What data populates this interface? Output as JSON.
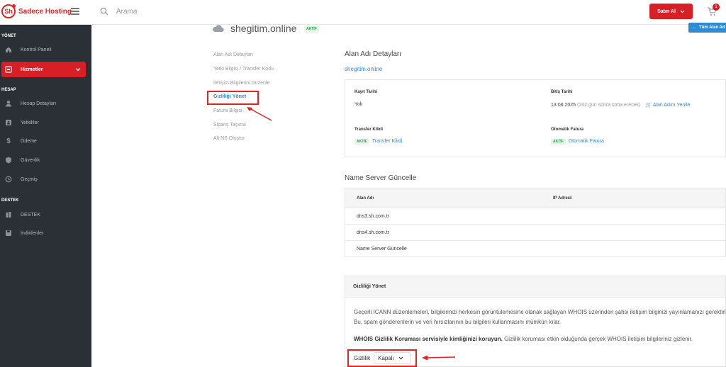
{
  "brand": {
    "name": "Sadece Hosting",
    "logo_mark": "Sh",
    "accent": "#d81f26",
    "link_color": "#2d8bd4"
  },
  "topbar": {
    "search_placeholder": "Arama",
    "buy_label": "Satın Al",
    "cart_count": "1"
  },
  "sidebar": {
    "sections": [
      "YÖNET",
      "HESAP",
      "DESTEK"
    ],
    "items": [
      {
        "label": "Kontrol Paneli",
        "icon": "home-icon"
      },
      {
        "label": "Hizmetler",
        "icon": "server-icon",
        "active": true
      },
      {
        "label": "Hesap Detayları",
        "icon": "user-icon"
      },
      {
        "label": "Yetkililer",
        "icon": "contacts-icon"
      },
      {
        "label": "Ödeme",
        "icon": "dollar-icon"
      },
      {
        "label": "Güvenlik",
        "icon": "shield-icon"
      },
      {
        "label": "Geçmiş",
        "icon": "history-icon"
      },
      {
        "label": "DESTEK",
        "icon": "support-icon"
      },
      {
        "label": "İndirilenler",
        "icon": "save-icon"
      }
    ]
  },
  "domain": {
    "name": "shegitim.online",
    "status": "AKTİF",
    "all_domains_label": "Tüm Alan Ad"
  },
  "left_nav": [
    "Alan Adı Detayları",
    "Yetki Bilgisi / Transfer Kodu",
    "İletişim Bilgilerini Düzenle",
    "Gizliliği Yönet",
    "Fatura Bilgisi",
    "Sipariş Taşıma",
    "Alt NS Oluştur"
  ],
  "details": {
    "heading": "Alan Adı Detayları",
    "domain_link": "shegitim.online",
    "registration_label": "Kayıt Tarihi",
    "registration_value": "Yok",
    "expiry_label": "Bitiş Tarihi",
    "expiry_date": "13.08.2025",
    "expiry_note": "(242 gün sonra sona erecek)",
    "renew_label": "Alan Adını Yenile",
    "transfer_lock_label": "Transfer Kilidi",
    "transfer_lock_status": "AKTİF",
    "transfer_lock_link": "Transfer Kilidi",
    "auto_invoice_label": "Otomatik Fatura",
    "auto_invoice_status": "AKTİF",
    "auto_invoice_link": "Otomatik Fatura"
  },
  "nameservers": {
    "heading": "Name Server Güncelle",
    "col_domain": "Alan Adı",
    "col_ip": "IP Adresi:",
    "rows": [
      "dns3.sh.com.tr",
      "dns4.sh.com.tr"
    ],
    "update_link": "Name Server Güncelle"
  },
  "privacy": {
    "heading": "Gizliliği Yönet",
    "text1": "Geçerli ICANN düzenlemeleri, bilgilerinizi herkesin görüntülemesine olanak sağlayan WHOIS üzerinden şahsi iletişim bilginizi yayınlamanızı gerektirir. Bu, spam gönderenlerin ve veri hırsızlarının bu bilgileri kullanmasını mümkün kılar.",
    "text2_bold": "WHOIS Gizlilik Koruması servisiyle kimliğinizi koruyun.",
    "text2_rest": " Gizlilik koruması etkin olduğunda gerçek WHOIS iletişim bilgileriniz gizlenir.",
    "control_label": "Gizlilik",
    "control_value": "Kapalı"
  }
}
